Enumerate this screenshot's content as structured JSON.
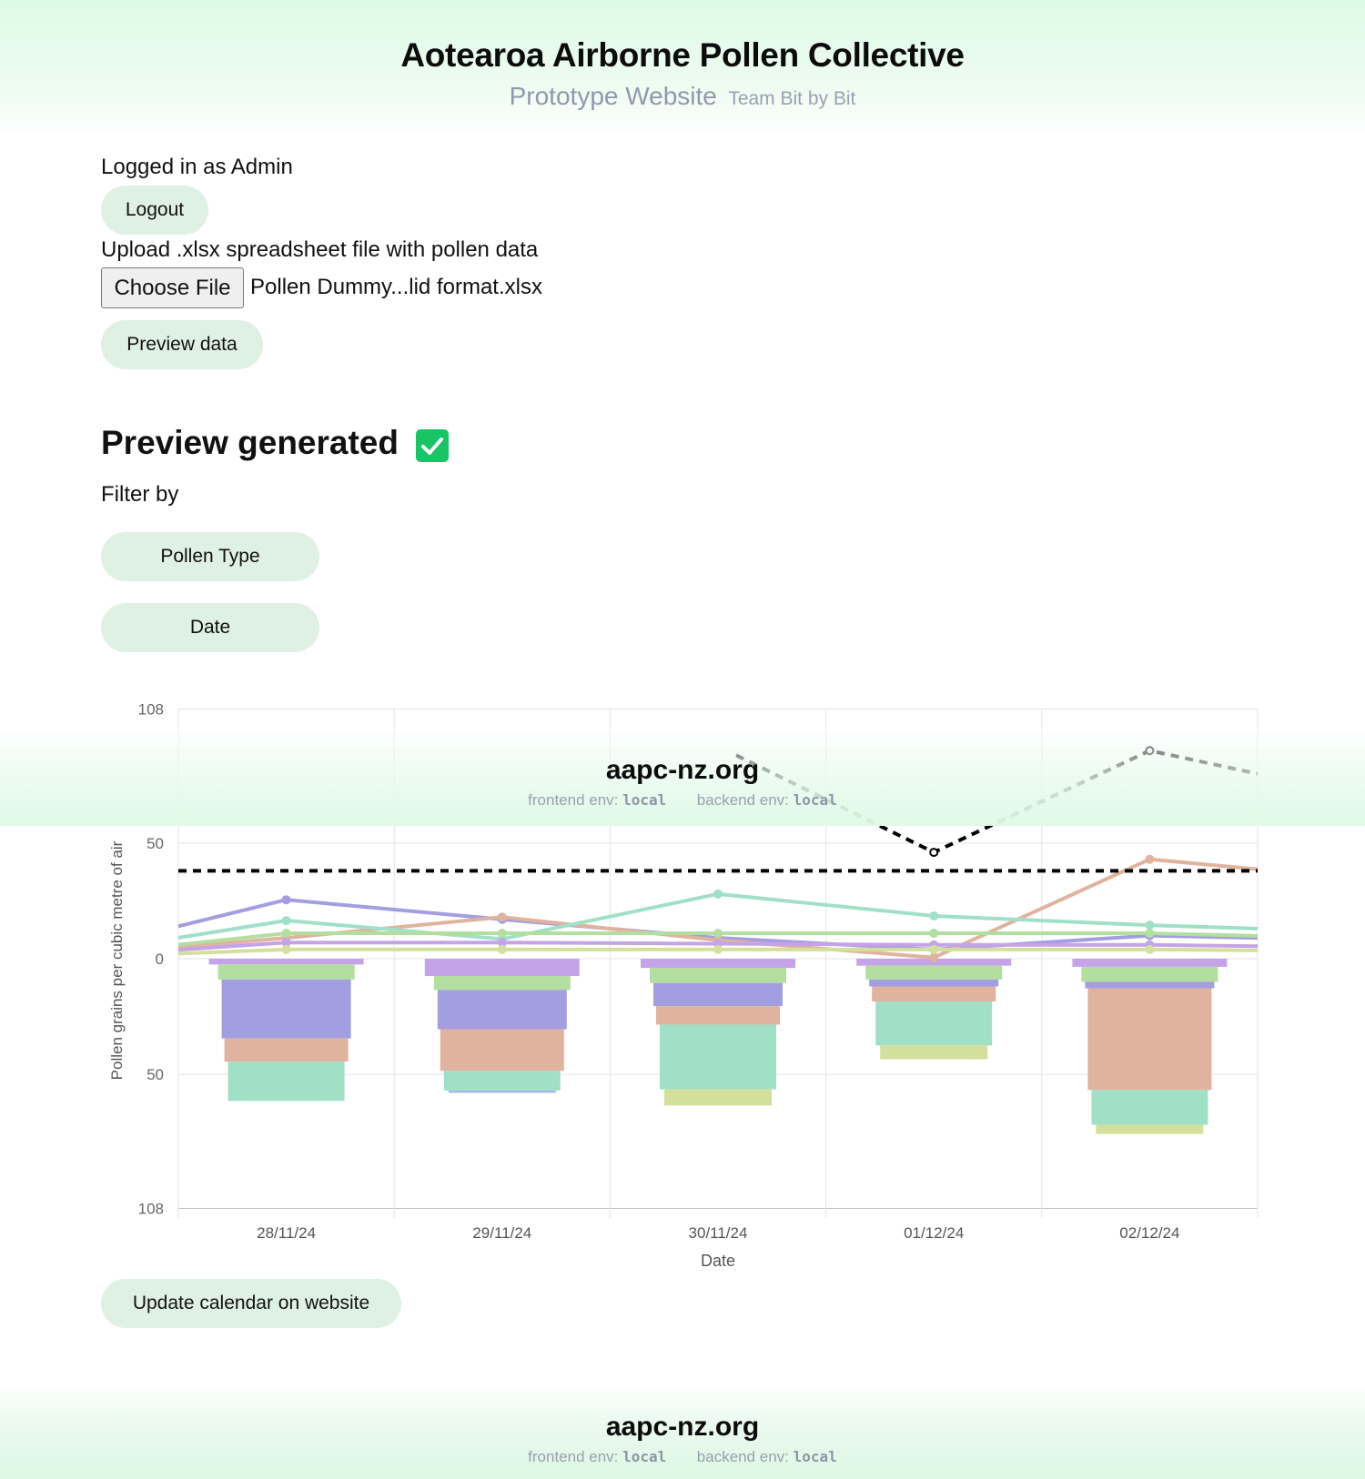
{
  "header": {
    "title": "Aotearoa Airborne Pollen Collective",
    "subtitle": "Prototype Website",
    "team": "Team Bit by Bit"
  },
  "session": {
    "logged_in_text": "Logged in as Admin",
    "logout_label": "Logout"
  },
  "upload": {
    "prompt": "Upload .xlsx spreadsheet file with pollen data",
    "choose_file_label": "Choose File",
    "file_name": "Pollen Dummy...lid format.xlsx",
    "preview_label": "Preview data"
  },
  "preview": {
    "heading": "Preview generated",
    "filter_label": "Filter by",
    "filters": [
      "Pollen Type",
      "Date"
    ],
    "update_label": "Update calendar on website",
    "check_color": "#18c464"
  },
  "chart_data": {
    "type": "bar",
    "xlabel": "Date",
    "ylabel": "Pollen grains per cubic metre of air",
    "ylim": [
      -108,
      108
    ],
    "y_tick_labels": [
      "108",
      "50",
      "0",
      "50",
      "108"
    ],
    "y_ticks": [
      108,
      50,
      0,
      -50,
      -108
    ],
    "grid": true,
    "categories": [
      "28/11/24",
      "29/11/24",
      "30/11/24",
      "01/12/24",
      "02/12/24"
    ],
    "threshold_line": {
      "style": "dashed",
      "value": 38,
      "color": "#000000"
    },
    "total_line": {
      "style": "dashed",
      "color": "#000000",
      "values": [
        null,
        null,
        null,
        46,
        90
      ]
    },
    "stacked_bars_below_axis": {
      "colors": [
        "#c4a3e8",
        "#b2dea0",
        "#a29ee0",
        "#e0b39e",
        "#9fe0c6",
        "#d3e09c",
        "#9fb8e6"
      ],
      "stacks": [
        [
          2.5,
          6.5,
          25.5,
          10,
          17
        ],
        [
          7.5,
          6,
          17,
          18,
          8.5,
          1
        ],
        [
          4,
          6.5,
          10,
          8,
          28,
          7
        ],
        [
          3,
          6,
          3,
          6.5,
          19,
          6
        ],
        [
          3.5,
          6.5,
          2.8,
          44,
          15,
          4
        ]
      ]
    },
    "line_series": [
      {
        "color": "#a29ee0",
        "values": [
          25.5,
          17,
          9,
          4,
          10
        ]
      },
      {
        "color": "#e0b39e",
        "values": [
          9,
          18,
          8,
          0.5,
          43
        ]
      },
      {
        "color": "#9fe0c6",
        "values": [
          16.5,
          8.5,
          28,
          18.5,
          14.5
        ]
      },
      {
        "color": "#b2dea0",
        "values": [
          11,
          11,
          11,
          11,
          11
        ]
      },
      {
        "color": "#c4a3e8",
        "values": [
          7,
          7,
          6.5,
          6,
          6
        ]
      },
      {
        "color": "#d3e09c",
        "values": [
          4,
          4,
          4,
          4,
          4
        ]
      }
    ]
  },
  "overlay_footer": {
    "domain": "aapc-nz.org",
    "frontend_label": "frontend env:",
    "frontend_value": "local",
    "backend_label": "backend env:",
    "backend_value": "local"
  },
  "footer": {
    "domain": "aapc-nz.org",
    "frontend_label": "frontend env:",
    "frontend_value": "local",
    "backend_label": "backend env:",
    "backend_value": "local"
  }
}
